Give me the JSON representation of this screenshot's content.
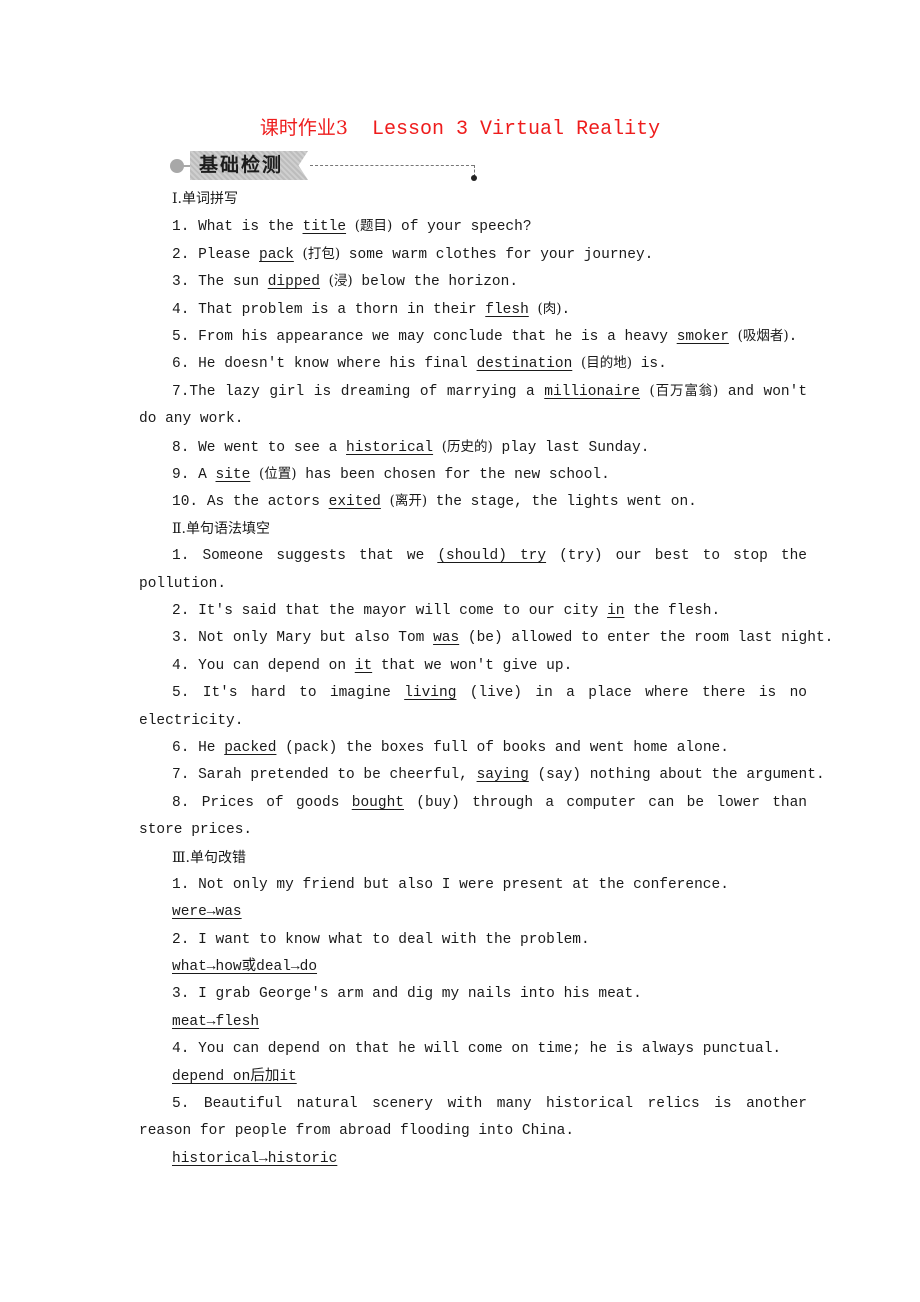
{
  "header": {
    "title_cn": "课时作业3",
    "title_en": "Lesson 3 Virtual Reality",
    "title_color": "#ee1c1c",
    "badge_label": "基础检测"
  },
  "sections": [
    {
      "heading": "Ⅰ.单词拼写",
      "items": [
        {
          "num": "1.",
          "before": "What is the ",
          "answer": "title",
          "hint": "(题目)",
          "after": " of your speech?"
        },
        {
          "num": "2.",
          "before": "Please ",
          "answer": "pack",
          "hint": "(打包)",
          "after": " some warm clothes for your journey."
        },
        {
          "num": "3.",
          "before": "The sun ",
          "answer": "dipped",
          "hint": "(浸)",
          "after": " below the horizon."
        },
        {
          "num": "4.",
          "before": "That problem is a thorn in their ",
          "answer": "flesh",
          "hint": "(肉)",
          "after": "."
        },
        {
          "num": "5.",
          "before": "From his appearance we may conclude that he is a heavy ",
          "answer": "smoker",
          "hint": "(吸烟者)",
          "after": "."
        },
        {
          "num": "6.",
          "before": "He doesn't know where his final ",
          "answer": "destination",
          "hint": "(目的地)",
          "after": " is."
        },
        {
          "num": "7.",
          "before": "The lazy girl is dreaming of marrying a ",
          "answer": "millionaire",
          "hint": "(百万富翁)",
          "after": " and won't do any work."
        },
        {
          "num": "8.",
          "before": "We went to see a ",
          "answer": "historical",
          "hint": "(历史的)",
          "after": " play last Sunday."
        },
        {
          "num": "9.",
          "before": "A ",
          "answer": "site",
          "hint": "(位置)",
          "after": " has been chosen for the new school."
        },
        {
          "num": "10.",
          "before": "As the actors ",
          "answer": "exited",
          "hint": "(离开)",
          "after": " the stage, the lights went on."
        }
      ]
    },
    {
      "heading": "Ⅱ.单句语法填空",
      "items": [
        {
          "num": "1.",
          "before": "Someone suggests that we ",
          "answer": "(should) try",
          "hint": "(try)",
          "after": " our best to stop the pollution."
        },
        {
          "num": "2.",
          "before": "It's said that the mayor will come to our city ",
          "answer": "in",
          "hint": "",
          "after": " the flesh."
        },
        {
          "num": "3.",
          "before": "Not only Mary but also Tom ",
          "answer": "was",
          "hint": "(be)",
          "after": " allowed to enter the room last night."
        },
        {
          "num": "4.",
          "before": "You can depend on ",
          "answer": "it",
          "hint": "",
          "after": " that we won't give up."
        },
        {
          "num": "5.",
          "before": "It's hard to imagine ",
          "answer": "living",
          "hint": "(live)",
          "after": " in a place where there is no electricity."
        },
        {
          "num": "6.",
          "before": "He ",
          "answer": "packed",
          "hint": "(pack)",
          "after": " the boxes full of books and went home alone."
        },
        {
          "num": "7.",
          "before": "Sarah pretended to be cheerful, ",
          "answer": "saying",
          "hint": "(say)",
          "after": " nothing about the argument."
        },
        {
          "num": "8.",
          "before": "Prices of goods ",
          "answer": "bought",
          "hint": "(buy)",
          "after": " through a computer can be lower than store prices."
        }
      ]
    },
    {
      "heading": "Ⅲ.单句改错",
      "items": [
        {
          "num": "1.",
          "sentence": "Not only my friend but also I were present at the conference.",
          "correction": "were→was"
        },
        {
          "num": "2.",
          "sentence": "I want to know what to deal with the problem.",
          "correction": "what→how或deal→do"
        },
        {
          "num": "3.",
          "sentence": "I grab George's arm and dig my nails into his meat.",
          "correction": "meat→flesh"
        },
        {
          "num": "4.",
          "sentence": "You can depend on that he will come on time; he is always punctual.",
          "correction": "depend on后加it"
        },
        {
          "num": "5.",
          "sentence": "Beautiful natural scenery with many historical relics is another reason for people from abroad flooding into China.",
          "correction": "historical→historic"
        }
      ]
    }
  ]
}
